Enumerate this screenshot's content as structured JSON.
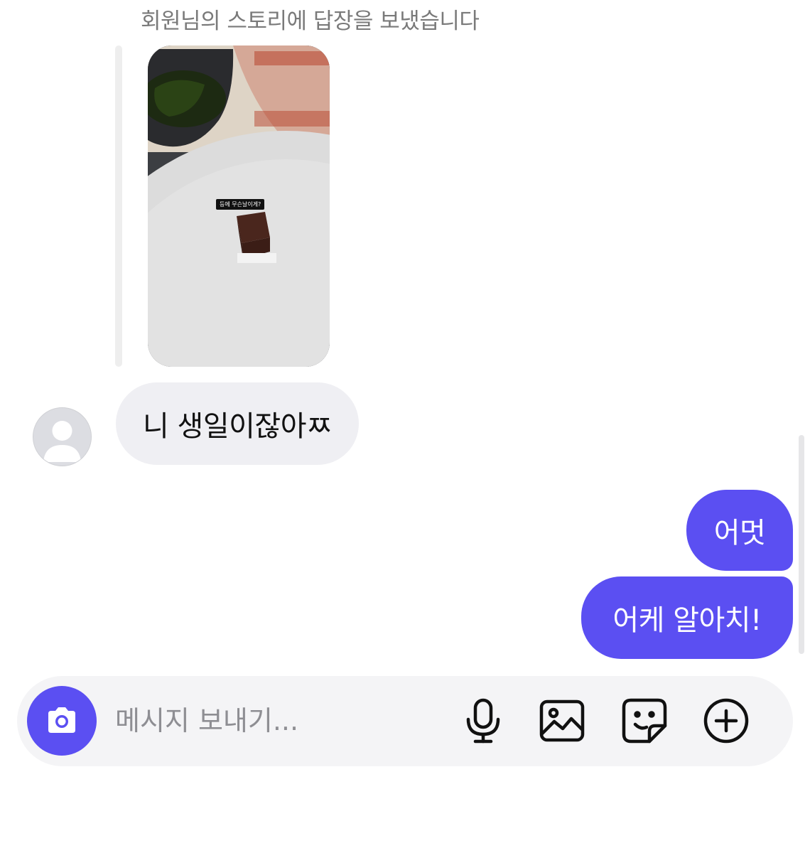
{
  "thread": {
    "story_reply_caption": "회원님의 스토리에 답장을 보냈습니다",
    "story_sticker_text": "등에 무슨날이게?",
    "messages": [
      {
        "sender": "them",
        "text": "니 생일이잖아ㅉ"
      },
      {
        "sender": "me",
        "text": "어멋"
      },
      {
        "sender": "me",
        "text": "어케 알아치!"
      }
    ]
  },
  "composer": {
    "placeholder": "메시지 보내기...",
    "value": ""
  },
  "icons": {
    "camera": "camera-icon",
    "mic": "microphone-icon",
    "gallery": "image-icon",
    "sticker": "sticker-icon",
    "more": "plus-circle-icon"
  },
  "colors": {
    "outgoing_bubble": "#5b4ff2",
    "incoming_bubble": "#efeff3",
    "camera_button": "#5b4ff2"
  }
}
